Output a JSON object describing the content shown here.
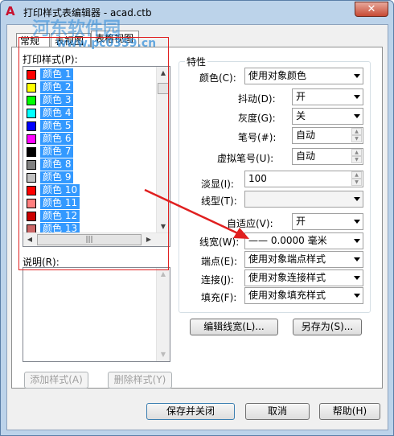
{
  "window": {
    "title": "打印样式表编辑器 - acad.ctb",
    "close_label": "✕"
  },
  "watermark": {
    "text": "河东软件园",
    "url": "www.pc0359.cn"
  },
  "tabs": [
    {
      "label": "常规"
    },
    {
      "label": "表视图"
    },
    {
      "label": "表格视图"
    }
  ],
  "print_styles": {
    "label": "打印样式(P):",
    "items": [
      {
        "label": "颜色 1",
        "color": "#ff0000"
      },
      {
        "label": "颜色 2",
        "color": "#ffff00"
      },
      {
        "label": "颜色 3",
        "color": "#00ff00"
      },
      {
        "label": "颜色 4",
        "color": "#00ffff"
      },
      {
        "label": "颜色 5",
        "color": "#0000ff"
      },
      {
        "label": "颜色 6",
        "color": "#ff00ff"
      },
      {
        "label": "颜色 7",
        "color": "#000000"
      },
      {
        "label": "颜色 8",
        "color": "#808080"
      },
      {
        "label": "颜色 9",
        "color": "#c0c0c0"
      },
      {
        "label": "颜色 10",
        "color": "#ff0000"
      },
      {
        "label": "颜色 11",
        "color": "#ff7f7f"
      },
      {
        "label": "颜色 12",
        "color": "#cc0000"
      },
      {
        "label": "颜色 13",
        "color": "#cc6666"
      }
    ]
  },
  "description": {
    "label": "说明(R):"
  },
  "buttons": {
    "add_style": "添加样式(A)",
    "delete_style": "删除样式(Y)",
    "edit_lineweight": "编辑线宽(L)...",
    "save_as": "另存为(S)...",
    "save_close": "保存并关闭",
    "cancel": "取消",
    "help": "帮助(H)"
  },
  "properties": {
    "title": "特性",
    "color_label": "颜色(C):",
    "color_value": "使用对象颜色",
    "dither_label": "抖动(D):",
    "dither_value": "开",
    "grayscale_label": "灰度(G):",
    "grayscale_value": "关",
    "pen_label": "笔号(#):",
    "pen_value": "自动",
    "virtual_pen_label": "虚拟笔号(U):",
    "virtual_pen_value": "自动",
    "screening_label": "淡显(I):",
    "screening_value": "100",
    "linetype_label": "线型(T):",
    "linetype_value": "",
    "adaptive_label": "自适应(V):",
    "adaptive_value": "开",
    "lineweight_label": "线宽(W):",
    "lineweight_value": "—— 0.0000 毫米",
    "endstyle_label": "端点(E):",
    "endstyle_value": "使用对象端点样式",
    "joinstyle_label": "连接(J):",
    "joinstyle_value": "使用对象连接样式",
    "fillstyle_label": "填充(F):",
    "fillstyle_value": "使用对象填充样式"
  },
  "annotation": {
    "arrow_color": "#e02020"
  }
}
